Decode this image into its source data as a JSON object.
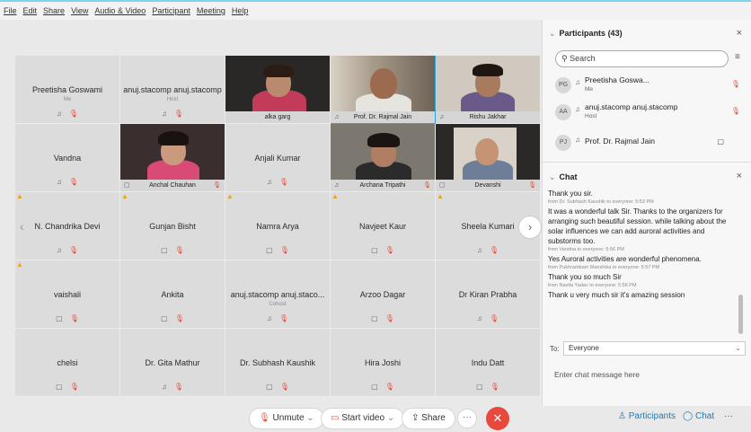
{
  "menu": [
    "File",
    "Edit",
    "Share",
    "View",
    "Audio & Video",
    "Participant",
    "Meeting",
    "Help"
  ],
  "tiles": [
    {
      "name": "Preetisha Goswami",
      "sub": "Me",
      "type": "avatar"
    },
    {
      "name": "anuj.stacomp anuj.stacomp",
      "sub": "Host",
      "type": "avatar"
    },
    {
      "name": "alka garg",
      "type": "video"
    },
    {
      "name": "Prof. Dr. Rajmal Jain",
      "type": "video"
    },
    {
      "name": "Rishu Jakhar",
      "type": "video"
    },
    {
      "name": "Vandna",
      "type": "avatar"
    },
    {
      "name": "Anchal Chauhan",
      "type": "video"
    },
    {
      "name": "Anjali Kumar",
      "type": "avatar"
    },
    {
      "name": "Archana Tripathi",
      "type": "video"
    },
    {
      "name": "Devanshi",
      "type": "video"
    },
    {
      "name": "N. Chandrika Devi",
      "type": "avatar"
    },
    {
      "name": "Gunjan Bisht",
      "type": "avatar"
    },
    {
      "name": "Namra Arya",
      "type": "avatar"
    },
    {
      "name": "Navjeet Kaur",
      "type": "avatar"
    },
    {
      "name": "Sheela Kumari",
      "type": "avatar"
    },
    {
      "name": "vaishali",
      "type": "avatar"
    },
    {
      "name": "Ankita",
      "type": "avatar"
    },
    {
      "name": "anuj.stacomp anuj.staco...",
      "sub": "Cohost",
      "type": "avatar"
    },
    {
      "name": "Arzoo Dagar",
      "type": "avatar"
    },
    {
      "name": "Dr Kiran Prabha",
      "type": "avatar"
    },
    {
      "name": "chelsi",
      "type": "avatar"
    },
    {
      "name": "Dr. Gita Mathur",
      "type": "avatar"
    },
    {
      "name": "Dr. Subhash Kaushik",
      "type": "avatar"
    },
    {
      "name": "Hira Joshi",
      "type": "avatar"
    },
    {
      "name": "Indu Datt",
      "type": "avatar"
    }
  ],
  "toolbar": {
    "unmute": "Unmute",
    "start_video": "Start video",
    "share": "Share",
    "participants": "Participants",
    "chat": "Chat"
  },
  "participants_panel": {
    "title": "Participants (43)",
    "search_placeholder": "Search",
    "items": [
      {
        "initials": "PG",
        "name": "Preetisha Goswa...",
        "role": "Me"
      },
      {
        "initials": "AA",
        "name": "anuj.stacomp anuj.stacomp",
        "role": "Host"
      },
      {
        "initials": "PJ",
        "name": "Prof. Dr. Rajmal Jain",
        "role": ""
      }
    ]
  },
  "chat_panel": {
    "title": "Chat",
    "messages": [
      {
        "text": "Thank you sir.",
        "meta": "from Dr. Subhash Kaushik to everyone:   5:53 PM"
      },
      {
        "text": "It was a wonderful talk Sir. Thanks to the organizers for arranging such beautiful session.  while talking about the solar influences we can add auroral activities and substorms too.",
        "meta": "from Vandna to everyone:   5:56 PM"
      },
      {
        "text": "Yes Auroral activities are wonderful phenomena.",
        "meta": "from Pukhrambam Manshika to everyone:   5:57 PM"
      },
      {
        "text": "Thank you so much Sir",
        "meta": "from Navita Yadav to everyone:   5:58 PM"
      },
      {
        "text": "Thank u very much sir it's amazing session",
        "meta": ""
      }
    ],
    "to_label": "To:",
    "to_value": "Everyone",
    "input_placeholder": "Enter chat message here"
  }
}
